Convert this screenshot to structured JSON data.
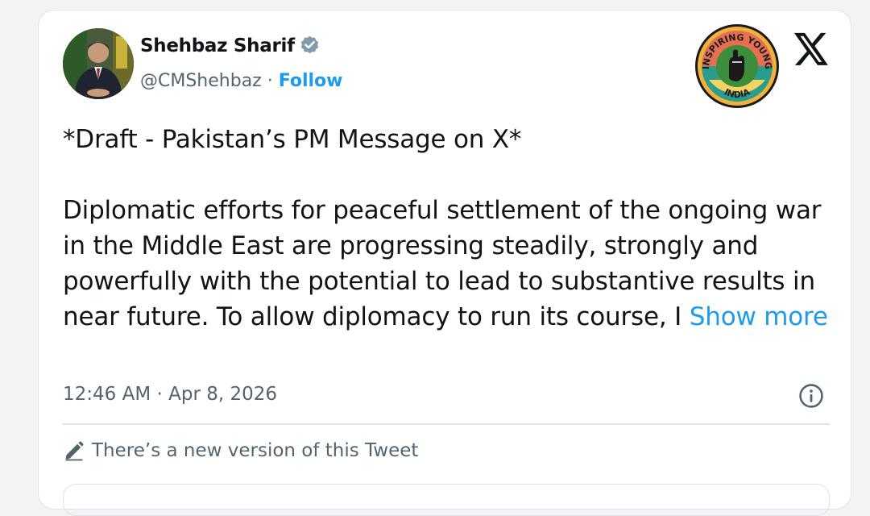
{
  "tweet": {
    "author_name": "Shehbaz Sharif",
    "handle": "@CMShehbaz",
    "separator": " · ",
    "follow_label": "Follow",
    "title_line": "*Draft - Pakistan’s PM Message on X*",
    "body_text": "Diplomatic efforts for peaceful settlement of the ongoing war in the Middle East are progressing steadily, strongly and powerfully with the potential to lead to substantive results in near future. To allow diplomacy to run its course, I ",
    "show_more_label": "Show more",
    "timestamp": "12:46 AM · Apr 8, 2026",
    "edit_notice": "There’s a new version of this Tweet"
  },
  "watermark": {
    "text_top": "INSPIRING YOUNG",
    "text_bottom": "INDIA"
  },
  "icons": {
    "verified": "verified-badge-icon",
    "x_logo": "x-logo-icon",
    "info": "info-icon",
    "pencil": "pencil-icon"
  },
  "colors": {
    "accent": "#1d9bf0",
    "text_primary": "#0f1419",
    "text_secondary": "#536471",
    "verified_badge": "#829aab"
  }
}
